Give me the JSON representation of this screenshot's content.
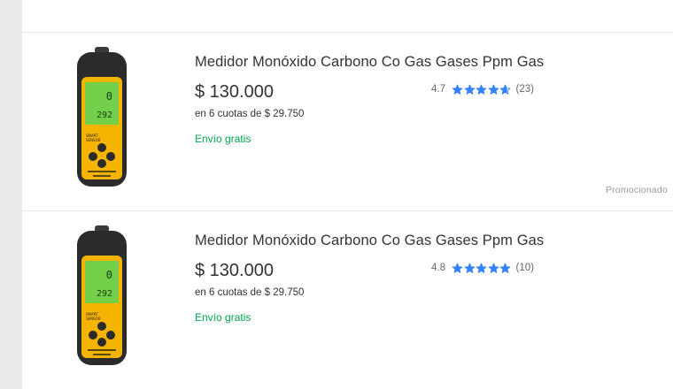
{
  "colors": {
    "star_fill": "#3483fa",
    "shipping_green": "#00a650",
    "device_body": "#2b2b2b",
    "device_yellow": "#f5b400",
    "device_screen": "#74d04a"
  },
  "results": [
    {
      "title": "Medidor Monóxido Carbono Co Gas Gases Ppm Gas",
      "price": "$ 130.000",
      "installments": "en 6 cuotas de $ 29.750",
      "shipping": "Envío gratis",
      "rating": {
        "score": "4.7",
        "stars": [
          1,
          1,
          1,
          1,
          0.7
        ],
        "reviews": "(23)"
      },
      "promoted_label": "Promocionado",
      "image_icon": "co-meter-device-icon"
    },
    {
      "title": "Medidor Monóxido Carbono Co Gas Gases Ppm Gas",
      "price": "$ 130.000",
      "installments": "en 6 cuotas de $ 29.750",
      "shipping": "Envío gratis",
      "rating": {
        "score": "4.8",
        "stars": [
          1,
          1,
          1,
          1,
          1
        ],
        "reviews": "(10)"
      },
      "image_icon": "co-meter-device-icon"
    }
  ]
}
